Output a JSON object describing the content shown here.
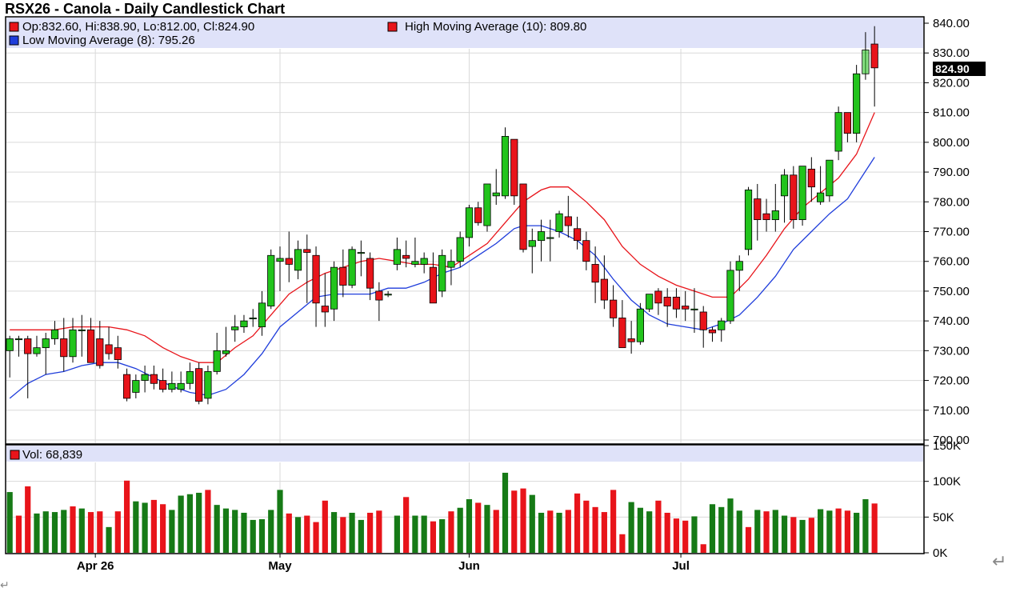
{
  "title": "RSX26 - Canola - Daily Candlestick Chart",
  "legend": {
    "ohlc": "Op:832.60, Hi:838.90, Lo:812.00, Cl:824.90",
    "high_ma": "High Moving Average (10): 809.80",
    "low_ma": "Low Moving Average (8): 795.26",
    "vol": "Vol: 68,839",
    "ohlc_color": "#e8141a",
    "high_ma_color": "#e8141a",
    "low_ma_color": "#1f3ddb",
    "vol_color": "#e8141a"
  },
  "last_price_tag": "824.90",
  "marks": {
    "return_large": "↵",
    "return_small": "↵"
  },
  "chart_data": [
    {
      "type": "candlestick",
      "title": "RSX26 - Canola - Daily Candlestick Chart",
      "ylim": [
        700,
        840
      ],
      "y_ticks": [
        "700.00",
        "710.00",
        "720.00",
        "730.00",
        "740.00",
        "750.00",
        "760.00",
        "770.00",
        "780.00",
        "790.00",
        "800.00",
        "810.00",
        "820.00",
        "830.00",
        "840.00"
      ],
      "x_labels": [
        "Apr 26",
        "May",
        "Jun",
        "Jul"
      ],
      "x_label_index": [
        9.5,
        30,
        51,
        74.5
      ],
      "colors": {
        "up": "#22c41c",
        "down": "#e8141a",
        "high_ma": "#e8141a",
        "low_ma": "#1f3ddb"
      },
      "ohlc": [
        [
          730,
          735,
          721,
          734
        ],
        [
          734,
          735,
          728,
          734
        ],
        [
          734,
          735,
          714,
          729
        ],
        [
          729,
          735,
          728,
          731
        ],
        [
          731,
          736,
          722,
          734
        ],
        [
          734,
          740,
          732,
          737
        ],
        [
          734,
          741,
          723,
          728
        ],
        [
          728,
          741,
          726,
          737
        ],
        [
          737,
          742,
          728,
          737
        ],
        [
          737,
          741,
          726,
          726
        ],
        [
          734,
          740,
          724,
          725
        ],
        [
          732,
          738,
          727,
          729
        ],
        [
          731,
          735,
          724,
          727
        ],
        [
          722,
          724,
          713,
          714
        ],
        [
          716,
          722,
          714,
          720
        ],
        [
          720,
          725,
          716,
          722
        ],
        [
          722,
          725,
          717,
          719
        ],
        [
          720,
          724,
          716,
          717
        ],
        [
          717,
          723,
          716,
          719
        ],
        [
          717,
          723,
          716,
          719
        ],
        [
          719,
          726,
          717,
          723
        ],
        [
          724,
          726,
          712,
          713
        ],
        [
          714,
          725,
          712,
          723
        ],
        [
          723,
          736,
          722,
          730
        ],
        [
          729,
          738,
          728,
          730
        ],
        [
          737,
          742,
          733,
          738
        ],
        [
          738,
          742,
          736,
          740
        ],
        [
          741,
          744,
          738,
          741
        ],
        [
          738,
          750,
          735,
          746
        ],
        [
          745,
          764,
          744,
          762
        ],
        [
          760,
          765,
          750,
          761
        ],
        [
          761,
          770,
          753,
          759
        ],
        [
          757,
          767,
          754,
          764
        ],
        [
          764,
          769,
          746,
          763
        ],
        [
          762,
          765,
          738,
          746
        ],
        [
          745,
          756,
          738,
          743
        ],
        [
          744,
          760,
          740,
          758
        ],
        [
          758,
          764,
          748,
          752
        ],
        [
          752,
          765,
          751,
          764
        ],
        [
          763,
          767,
          755,
          763
        ],
        [
          761,
          763,
          747,
          751
        ],
        [
          750,
          753,
          740,
          747
        ],
        [
          749,
          750,
          748,
          749
        ],
        [
          759,
          768,
          757,
          764
        ],
        [
          762,
          767,
          758,
          761
        ],
        [
          759,
          768,
          758,
          760
        ],
        [
          759,
          763,
          756,
          761
        ],
        [
          758,
          763,
          746,
          746
        ],
        [
          750,
          764,
          748,
          762
        ],
        [
          758,
          764,
          752,
          760
        ],
        [
          760,
          770,
          758,
          768
        ],
        [
          768,
          779,
          765,
          778
        ],
        [
          778,
          780,
          772,
          773
        ],
        [
          772,
          786,
          770,
          786
        ],
        [
          782,
          791,
          779,
          783
        ],
        [
          782,
          805,
          781,
          802
        ],
        [
          801,
          801,
          779,
          782
        ],
        [
          786,
          786,
          763,
          764
        ],
        [
          765,
          771,
          756,
          767
        ],
        [
          767,
          774,
          760,
          770
        ],
        [
          768,
          774,
          760,
          768
        ],
        [
          770,
          777,
          768,
          776
        ],
        [
          775,
          782,
          768,
          772
        ],
        [
          771,
          775,
          764,
          767
        ],
        [
          767,
          770,
          757,
          760
        ],
        [
          759,
          765,
          746,
          753
        ],
        [
          754,
          762,
          744,
          747
        ],
        [
          747,
          752,
          738,
          741
        ],
        [
          741,
          747,
          733,
          731
        ],
        [
          734,
          740,
          729,
          733
        ],
        [
          733,
          746,
          732,
          744
        ],
        [
          744,
          749,
          743,
          749
        ],
        [
          750,
          751,
          742,
          746
        ],
        [
          748,
          751,
          738,
          745
        ],
        [
          748,
          751,
          741,
          744
        ],
        [
          745,
          750,
          740,
          744
        ],
        [
          744,
          751,
          736,
          744
        ],
        [
          743,
          745,
          731,
          737
        ],
        [
          737,
          738,
          733,
          736
        ],
        [
          737,
          741,
          733,
          740
        ],
        [
          740,
          760,
          739,
          757
        ],
        [
          757,
          762,
          750,
          760
        ],
        [
          764,
          785,
          762,
          784
        ],
        [
          781,
          786,
          767,
          774
        ],
        [
          776,
          781,
          770,
          774
        ],
        [
          774,
          786,
          770,
          777
        ],
        [
          782,
          791,
          773,
          789
        ],
        [
          789,
          792,
          771,
          774
        ],
        [
          774,
          792,
          772,
          792
        ],
        [
          791,
          795,
          780,
          785
        ],
        [
          780,
          792,
          779,
          783
        ],
        [
          782,
          794,
          780,
          794
        ],
        [
          797,
          812,
          794,
          810
        ],
        [
          810,
          810,
          800,
          803
        ],
        [
          803,
          826,
          800,
          823
        ],
        [
          823,
          837,
          821,
          831
        ],
        [
          833,
          839,
          812,
          825
        ]
      ],
      "high_ma": [
        [
          0,
          737
        ],
        [
          3,
          737
        ],
        [
          5,
          737
        ],
        [
          7,
          738
        ],
        [
          9,
          738
        ],
        [
          11,
          738
        ],
        [
          13,
          737
        ],
        [
          15,
          735
        ],
        [
          17,
          731
        ],
        [
          19,
          728
        ],
        [
          21,
          726
        ],
        [
          23,
          726
        ],
        [
          25,
          731
        ],
        [
          27,
          735
        ],
        [
          29,
          742
        ],
        [
          31,
          749
        ],
        [
          33,
          753
        ],
        [
          35,
          756
        ],
        [
          37,
          758
        ],
        [
          39,
          760
        ],
        [
          41,
          761
        ],
        [
          43,
          760
        ],
        [
          45,
          759
        ],
        [
          47,
          759
        ],
        [
          49,
          758
        ],
        [
          51,
          762
        ],
        [
          53,
          766
        ],
        [
          55,
          773
        ],
        [
          57,
          780
        ],
        [
          59,
          784
        ],
        [
          60,
          785
        ],
        [
          62,
          785
        ],
        [
          64,
          780
        ],
        [
          66,
          774
        ],
        [
          68,
          765
        ],
        [
          70,
          759
        ],
        [
          72,
          755
        ],
        [
          74,
          752
        ],
        [
          76,
          750
        ],
        [
          78,
          748
        ],
        [
          80,
          748
        ],
        [
          82,
          754
        ],
        [
          84,
          762
        ],
        [
          86,
          771
        ],
        [
          88,
          778
        ],
        [
          90,
          783
        ],
        [
          92,
          788
        ],
        [
          94,
          796
        ],
        [
          96,
          810
        ]
      ],
      "low_ma": [
        [
          0,
          714
        ],
        [
          2,
          719
        ],
        [
          4,
          722
        ],
        [
          6,
          723
        ],
        [
          8,
          725
        ],
        [
          10,
          726
        ],
        [
          12,
          726
        ],
        [
          14,
          724
        ],
        [
          16,
          721
        ],
        [
          18,
          718
        ],
        [
          20,
          716
        ],
        [
          22,
          715
        ],
        [
          24,
          717
        ],
        [
          26,
          722
        ],
        [
          28,
          729
        ],
        [
          30,
          738
        ],
        [
          32,
          743
        ],
        [
          34,
          748
        ],
        [
          36,
          749
        ],
        [
          38,
          749
        ],
        [
          40,
          749
        ],
        [
          42,
          751
        ],
        [
          44,
          751
        ],
        [
          46,
          753
        ],
        [
          48,
          756
        ],
        [
          50,
          758
        ],
        [
          52,
          762
        ],
        [
          54,
          766
        ],
        [
          56,
          771
        ],
        [
          57,
          772
        ],
        [
          59,
          772
        ],
        [
          61,
          770
        ],
        [
          63,
          767
        ],
        [
          65,
          762
        ],
        [
          67,
          754
        ],
        [
          69,
          747
        ],
        [
          71,
          742
        ],
        [
          73,
          739
        ],
        [
          75,
          738
        ],
        [
          77,
          737
        ],
        [
          79,
          739
        ],
        [
          81,
          742
        ],
        [
          83,
          748
        ],
        [
          85,
          755
        ],
        [
          87,
          764
        ],
        [
          89,
          770
        ],
        [
          91,
          776
        ],
        [
          93,
          781
        ],
        [
          96,
          795
        ]
      ]
    },
    {
      "type": "bar",
      "title": "Vol: 68,839",
      "ylim": [
        0,
        150000
      ],
      "y_ticks": [
        "150K",
        "100K",
        "50K",
        "0K"
      ],
      "colors": {
        "up": "#167a16",
        "down": "#e8141a",
        "neutral": "#0c0c6e"
      },
      "values": [
        85000,
        52000,
        93000,
        55000,
        58000,
        57000,
        60000,
        65000,
        62000,
        57000,
        58000,
        36000,
        58000,
        101000,
        72000,
        70000,
        74000,
        68000,
        60000,
        80000,
        82000,
        84000,
        88000,
        67000,
        62000,
        60000,
        56000,
        46000,
        47000,
        60000,
        88000,
        55000,
        50000,
        52000,
        43000,
        73000,
        57000,
        50000,
        56000,
        46000,
        56000,
        59000,
        0,
        52000,
        78000,
        52000,
        52000,
        44000,
        47000,
        58000,
        63000,
        75000,
        70000,
        67000,
        60000,
        112000,
        87000,
        90000,
        81000,
        56000,
        59000,
        56000,
        60000,
        83000,
        73000,
        64000,
        57000,
        88000,
        26000,
        71000,
        63000,
        58000,
        73000,
        56000,
        48000,
        45000,
        51000,
        12000,
        68000,
        64000,
        76000,
        59000,
        36000,
        60000,
        58000,
        60000,
        52000,
        50000,
        46000,
        49000,
        61000,
        59000,
        62000,
        59000,
        56000,
        75000,
        69000
      ],
      "direction": [
        "up",
        "down",
        "down",
        "up",
        "up",
        "up",
        "up",
        "down",
        "up",
        "down",
        "down",
        "up",
        "down",
        "down",
        "up",
        "up",
        "down",
        "down",
        "up",
        "up",
        "up",
        "up",
        "down",
        "up",
        "up",
        "up",
        "up",
        "up",
        "up",
        "up",
        "up",
        "down",
        "up",
        "down",
        "down",
        "down",
        "up",
        "down",
        "up",
        "up",
        "down",
        "down",
        "neutral",
        "up",
        "down",
        "up",
        "up",
        "down",
        "up",
        "down",
        "up",
        "up",
        "down",
        "up",
        "down",
        "up",
        "down",
        "down",
        "up",
        "up",
        "down",
        "up",
        "down",
        "down",
        "down",
        "down",
        "down",
        "down",
        "down",
        "up",
        "up",
        "up",
        "down",
        "down",
        "down",
        "down",
        "up",
        "down",
        "up",
        "up",
        "up",
        "up",
        "down",
        "up",
        "down",
        "up",
        "up",
        "down",
        "up",
        "down",
        "up",
        "up",
        "down",
        "down",
        "up",
        "up",
        "down"
      ]
    }
  ]
}
